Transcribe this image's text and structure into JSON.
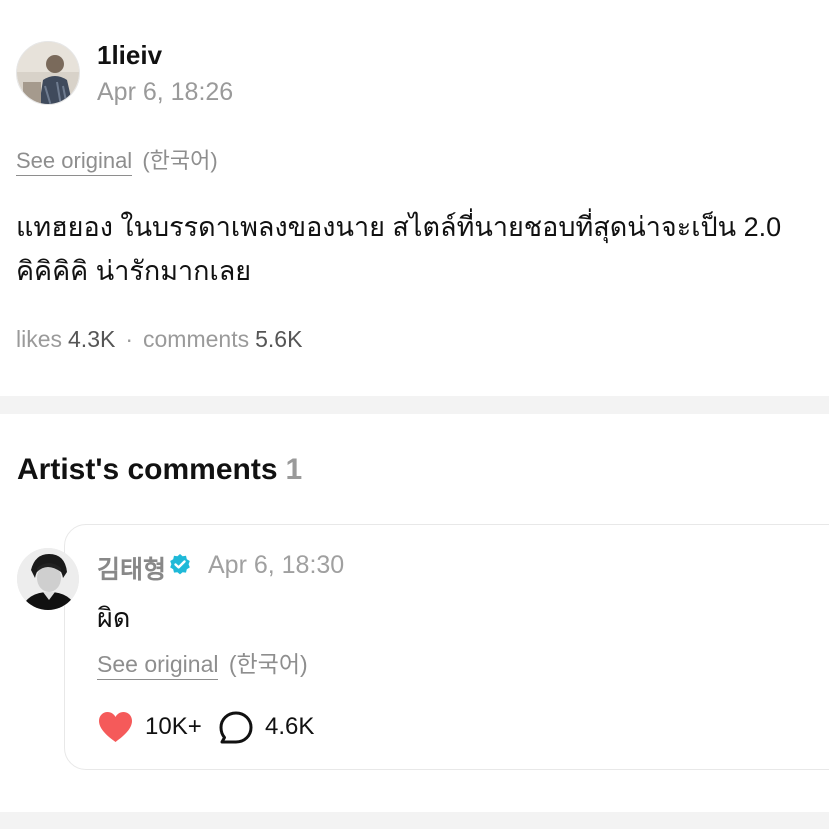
{
  "post": {
    "author": "1lieiv",
    "timestamp": "Apr 6, 18:26",
    "see_original": "See original",
    "language": "(한국어)",
    "text_line1": "แทฮยอง ในบรรดาเพลงของนาย สไตล์ที่นายชอบที่สุดน่าจะเป็น 2.0",
    "text_line2": "คิคิคิคิ น่ารักมากเลย",
    "likes_label": "likes",
    "likes_value": "4.3K",
    "separator": "·",
    "comments_label": "comments",
    "comments_value": "5.6K"
  },
  "artist_comments": {
    "title": "Artist's comments",
    "count": "1",
    "comment": {
      "author": "김태형",
      "timestamp": "Apr 6, 18:30",
      "text": "ผิด",
      "see_original": "See original",
      "language": "(한국어)",
      "likes": "10K+",
      "replies": "4.6K",
      "verified_color": "#1fb9d8",
      "heart_color": "#f55a5a"
    }
  }
}
